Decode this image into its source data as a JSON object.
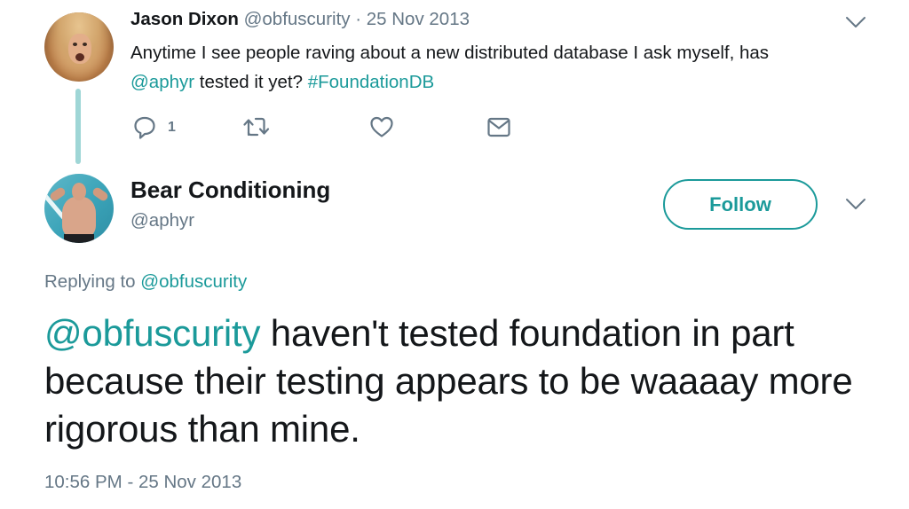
{
  "parent_tweet": {
    "author_name": "Jason Dixon",
    "author_handle": "@obfuscurity",
    "separator": " · ",
    "date": "25 Nov 2013",
    "text_line1": "Anytime I see people raving about a new distributed database I ask myself, has",
    "mention": "@aphyr",
    "text_mid": " tested it yet? ",
    "hashtag": "#FoundationDB",
    "reply_count": "1",
    "avatar_icon": "jason-dixon-avatar",
    "menu_icon": "chevron-down-icon"
  },
  "main_tweet": {
    "author_name": "Bear Conditioning",
    "author_handle": "@aphyr",
    "follow_label": "Follow",
    "replying_prefix": "Replying to ",
    "replying_to": "@obfuscurity",
    "mention": "@obfuscurity",
    "text": " haven't tested foundation in part because their testing appears to be waaaay more rigorous than mine.",
    "timestamp": "10:56 PM - 25 Nov 2013",
    "avatar_icon": "bear-conditioning-avatar",
    "menu_icon": "chevron-down-icon"
  },
  "colors": {
    "accent": "#1b9a9a",
    "thread_line": "#9fd6d6",
    "muted_text": "#657786",
    "primary_text": "#14171a"
  },
  "icons": {
    "reply": "reply-bubble-icon",
    "retweet": "retweet-icon",
    "like": "heart-icon",
    "dm": "envelope-icon"
  }
}
